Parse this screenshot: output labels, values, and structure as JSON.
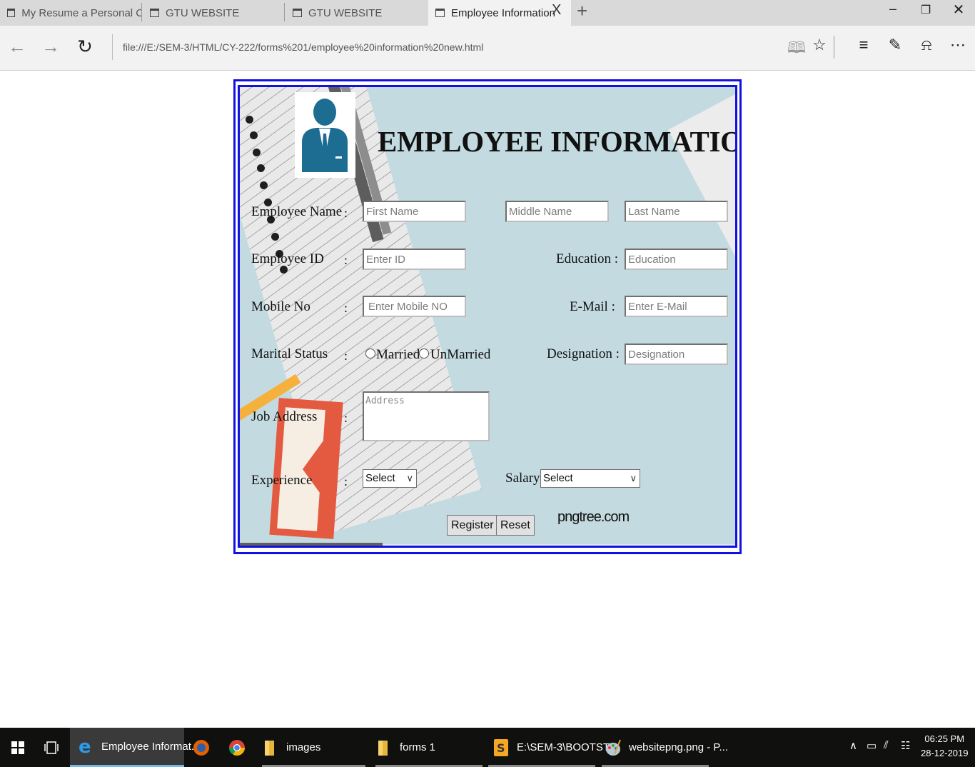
{
  "browser": {
    "tabs": [
      {
        "label": "My Resume a Personal Categ",
        "active": false
      },
      {
        "label": "GTU WEBSITE",
        "active": false
      },
      {
        "label": "GTU WEBSITE",
        "active": false
      },
      {
        "label": "Employee Information",
        "active": true
      }
    ],
    "close_tab": "X",
    "new_tab": "+",
    "url": "file:///E:/SEM-3/HTML/CY-222/forms%201/employee%20information%20new.html"
  },
  "form": {
    "title": "EMPLOYEE INFORMATION",
    "employee_name_label": "Employee Name",
    "first_name_placeholder": "First Name",
    "middle_name_placeholder": "Middle Name",
    "last_name_placeholder": "Last Name",
    "employee_id_label": "Employee ID",
    "employee_id_placeholder": "Enter ID",
    "education_label": "Education :",
    "education_placeholder": "Education",
    "mobile_label": "Mobile No",
    "mobile_placeholder": "Enter Mobile NO",
    "email_label": "E-Mail :",
    "email_placeholder": "Enter E-Mail",
    "marital_label": "Marital Status",
    "married_label": "Married",
    "unmarried_label": "UnMarried",
    "designation_label": "Designation :",
    "designation_placeholder": "Designation",
    "job_address_label": "Job Address",
    "address_placeholder": "Address",
    "experience_label": "Experience",
    "experience_value": "Select",
    "salary_label": "Salary:",
    "salary_value": "Select",
    "colon": ":",
    "register_label": "Register",
    "reset_label": "Reset",
    "watermark": "pngtree.com"
  },
  "taskbar": {
    "items": [
      {
        "label": "Employee Informat...",
        "icon": "edge-icon",
        "active": true
      },
      {
        "label": "",
        "icon": "firefox-icon",
        "active": false
      },
      {
        "label": "",
        "icon": "chrome-icon",
        "active": false
      },
      {
        "label": "images",
        "icon": "folder-icon",
        "active": false
      },
      {
        "label": "forms 1",
        "icon": "folder-icon",
        "active": false
      },
      {
        "label": "E:\\SEM-3\\BOOTST...",
        "icon": "sublime-icon",
        "active": false
      },
      {
        "label": "websitepng.png - P...",
        "icon": "paint-icon",
        "active": false
      }
    ],
    "time": "06:25 PM",
    "date": "28-12-2019"
  }
}
